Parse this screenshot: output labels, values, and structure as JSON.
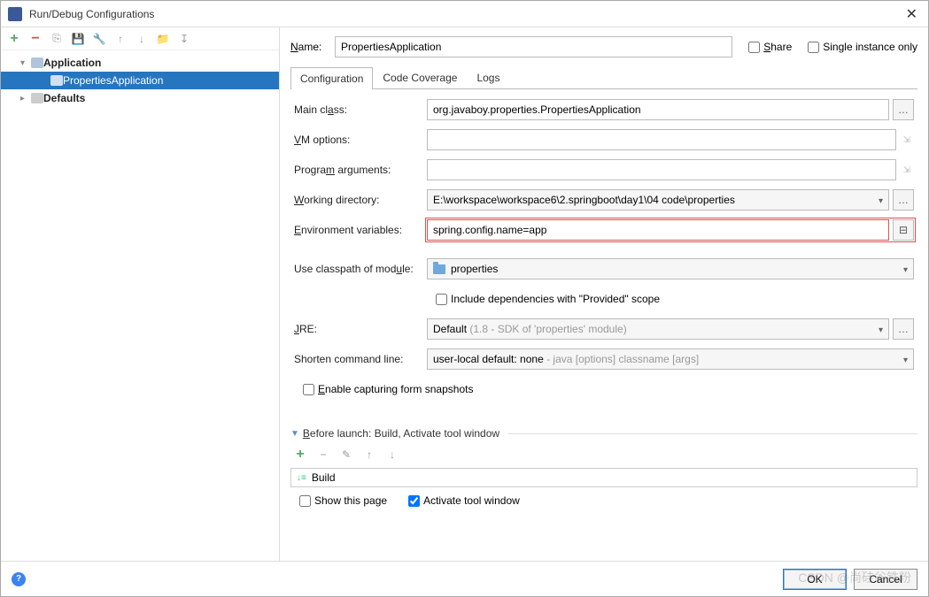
{
  "window": {
    "title": "Run/Debug Configurations"
  },
  "tree": {
    "root1": "Application",
    "child1": "PropertiesApplication",
    "root2": "Defaults"
  },
  "header": {
    "name_label": "Name:",
    "name_value": "PropertiesApplication",
    "share_label": "Share",
    "single_label": "Single instance only"
  },
  "tabs": {
    "t1": "Configuration",
    "t2": "Code Coverage",
    "t3": "Logs"
  },
  "form": {
    "main_class_label": "Main class:",
    "main_class_value": "org.javaboy.properties.PropertiesApplication",
    "vm_label": "VM options:",
    "vm_value": "",
    "prog_args_label": "Program arguments:",
    "prog_args_value": "",
    "workdir_label": "Working directory:",
    "workdir_value": "E:\\workspace\\workspace6\\2.springboot\\day1\\04 code\\properties",
    "env_label": "Environment variables:",
    "env_value": "spring.config.name=app",
    "classpath_label": "Use classpath of module:",
    "classpath_value": "properties",
    "include_provided_label": "Include dependencies with \"Provided\" scope",
    "jre_label": "JRE:",
    "jre_value": "Default",
    "jre_hint": " (1.8 - SDK of 'properties' module)",
    "shorten_label": "Shorten command line:",
    "shorten_value": "user-local default: none",
    "shorten_hint": " - java [options] classname [args]",
    "enable_snapshots_label": "Enable capturing form snapshots"
  },
  "before_launch": {
    "title": "Before launch: Build, Activate tool window",
    "item1": "Build",
    "show_page": "Show this page",
    "activate_tool": "Activate tool window"
  },
  "buttons": {
    "ok": "OK",
    "cancel": "Cancel"
  },
  "watermark": "CSDN @尚硅谷铁粉"
}
